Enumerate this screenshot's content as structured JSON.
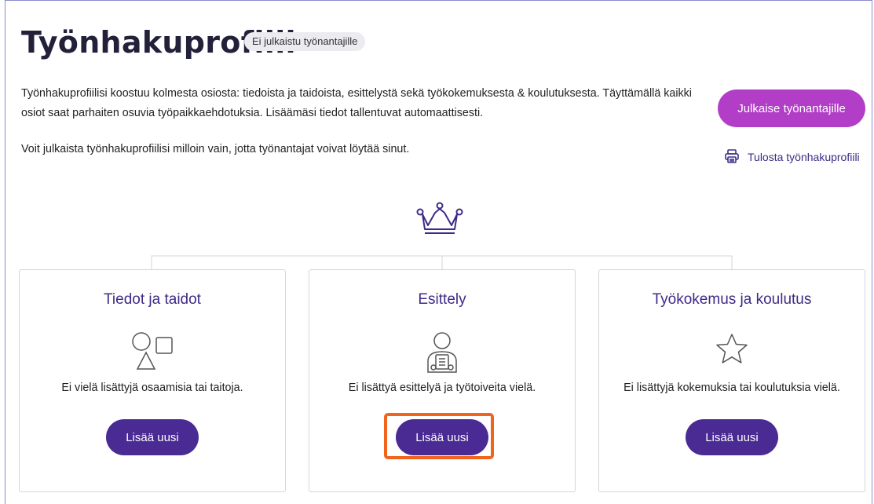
{
  "page": {
    "title": "Työnhakuprofiili",
    "badge": "Ei julkaistu työnantajille",
    "intro_line1": "Työnhakuprofiilisi koostuu kolmesta osiosta: tiedoista ja taidoista, esittelystä sekä työkokemuksesta & koulutuksesta. Täyttämällä kaikki",
    "intro_line2": "osiot saat parhaiten osuvia työpaikkaehdotuksia. Lisäämäsi tiedot tallentuvat automaattisesti.",
    "intro_para2": "Voit julkaista työnhakuprofiilisi milloin vain, jotta työnantajat voivat löytää sinut.",
    "publish_label": "Julkaise työnantajille",
    "print_label": "Tulosta työnhakuprofiili"
  },
  "cards": [
    {
      "title": "Tiedot ja taidot",
      "icon": "shapes-icon",
      "empty_text": "Ei vielä lisättyjä osaamisia tai taitoja.",
      "button_label": "Lisää uusi"
    },
    {
      "title": "Esittely",
      "icon": "person-document-icon",
      "empty_text": "Ei lisättyä esittelyä ja työtoiveita vielä.",
      "button_label": "Lisää uusi"
    },
    {
      "title": "Työkokemus ja koulutus",
      "icon": "star-icon",
      "empty_text": "Ei lisättyjä kokemuksia tai koulutuksia vielä.",
      "button_label": "Lisää uusi"
    }
  ],
  "colors": {
    "accent_purple": "#b23ec7",
    "primary_purple": "#4a2a93",
    "heading_purple": "#3f2b86",
    "highlight_orange": "#f0641e"
  }
}
